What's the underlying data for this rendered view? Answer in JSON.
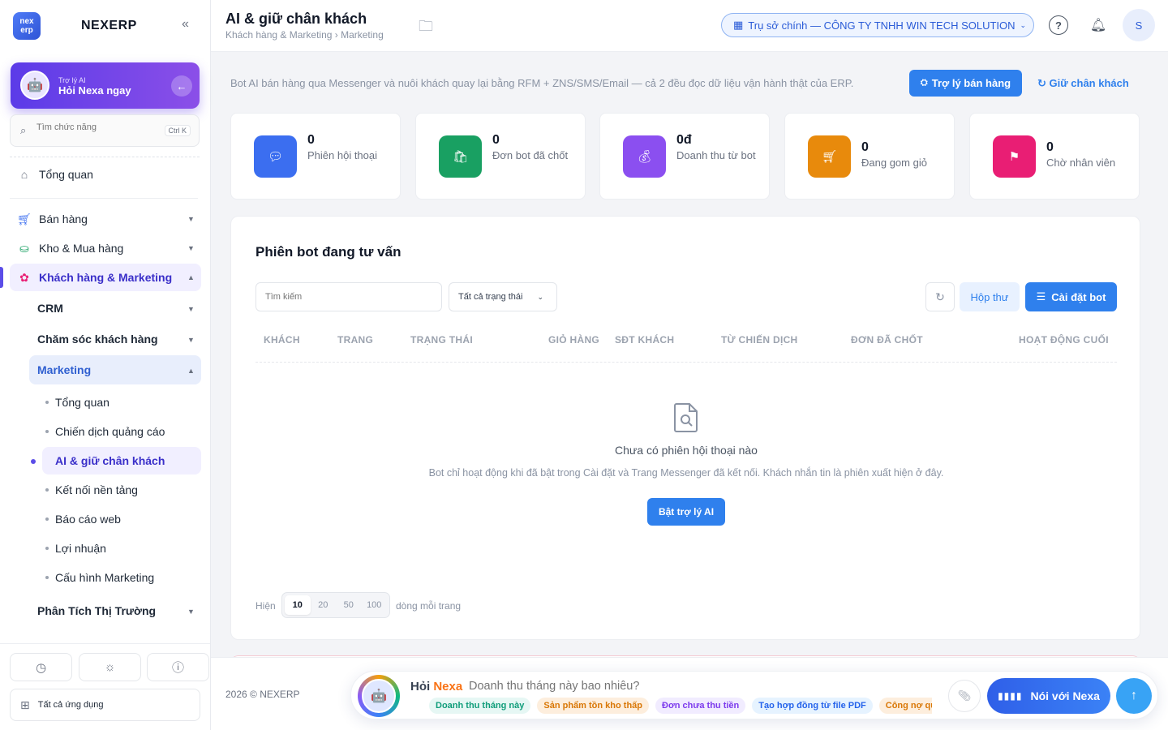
{
  "brand": {
    "logo_text": "nex erp",
    "name": "NEXERP",
    "collapse_icon": "«"
  },
  "ai_card": {
    "small": "Trợ lý AI",
    "big": "Hỏi Nexa ngay",
    "arrow": "←"
  },
  "search": {
    "placeholder": "Tìm chức năng",
    "shortcut": "Ctrl K"
  },
  "nav": {
    "overview": "Tổng quan",
    "sales": "Bán hàng",
    "warehouse": "Kho & Mua hàng",
    "customers": "Khách hàng & Marketing",
    "crm": "CRM",
    "care": "Chăm sóc khách hàng",
    "marketing": "Marketing",
    "marketing_items": [
      "Tổng quan",
      "Chiến dịch quảng cáo",
      "AI & giữ chân khách",
      "Kết nối nền tảng",
      "Báo cáo web",
      "Lợi nhuận",
      "Cấu hình Marketing"
    ],
    "market_analysis": "Phân Tích Thị Trường",
    "chev_down": "▼",
    "chev_up": "▲"
  },
  "sidebar_bottom": {
    "all_apps": "Tất cả ứng dụng"
  },
  "header": {
    "title": "AI & giữ chân khách",
    "breadcrumb": "Khách hàng & Marketing › Marketing",
    "branch": "Trụ sở chính — CÔNG TY TNHH WIN TECH SOLUTION",
    "avatar": "S"
  },
  "intro": "Bot AI bán hàng qua Messenger và nuôi khách quay lại bằng RFM + ZNS/SMS/Email — cả 2 đều đọc dữ liệu vận hành thật của ERP.",
  "actions": {
    "assistant": "Trợ lý bán hàng",
    "retain": "Giữ chân khách"
  },
  "stats": [
    {
      "value": "0",
      "label": "Phiên hội thoại",
      "color": "#3b6ef0"
    },
    {
      "value": "0",
      "label": "Đơn bot đã chốt",
      "color": "#19a062"
    },
    {
      "value": "0đ",
      "label": "Doanh thu từ bot",
      "color": "#8b4ff0"
    },
    {
      "value": "0",
      "label": "Đang gom giỏ",
      "color": "#e88a0c"
    },
    {
      "value": "0",
      "label": "Chờ nhân viên",
      "color": "#e91e74"
    }
  ],
  "panel": {
    "title": "Phiên bot đang tư vấn",
    "search_placeholder": "Tìm kiếm",
    "status_filter": "Tất cả trạng thái",
    "inbox": "Hộp thư",
    "setup_bot": "Cài đặt bot",
    "columns": [
      "KHÁCH",
      "TRANG",
      "TRẠNG THÁI",
      "GIỎ HÀNG",
      "SĐT KHÁCH",
      "TỪ CHIẾN DỊCH",
      "ĐƠN ĐÃ CHỐT",
      "HOẠT ĐỘNG CUỐI"
    ],
    "empty_title": "Chưa có phiên hội thoại nào",
    "empty_desc": "Bot chỉ hoạt động khi đã bật trong Cài đặt và Trang Messenger đã kết nối. Khách nhắn tin là phiên xuất hiện ở đây.",
    "enable_button": "Bật trợ lý AI",
    "show_label": "Hiện",
    "page_sizes": [
      "10",
      "20",
      "50",
      "100"
    ],
    "page_size_selected": "10",
    "per_page_label": "dòng mỗi trang"
  },
  "footer": {
    "copyright": "2026 © NEXERP",
    "ask": "Hỏi",
    "ask_brand": "Nexa",
    "prompt": "Doanh thu tháng này bao nhiêu?",
    "chips": [
      {
        "label": "Doanh thu tháng này",
        "bg": "#e6f7f4",
        "fg": "#0f9d7a"
      },
      {
        "label": "Sản phẩm tồn kho thấp",
        "bg": "#fdeedd",
        "fg": "#d97706"
      },
      {
        "label": "Đơn chưa thu tiền",
        "bg": "#f1ecff",
        "fg": "#7c3aed"
      },
      {
        "label": "Tạo hợp đồng từ file PDF",
        "bg": "#e6f3ff",
        "fg": "#2563eb"
      },
      {
        "label": "Công nợ quá hạn",
        "bg": "#fdeedd",
        "fg": "#d97706"
      }
    ],
    "talk": "Nói với Nexa"
  }
}
